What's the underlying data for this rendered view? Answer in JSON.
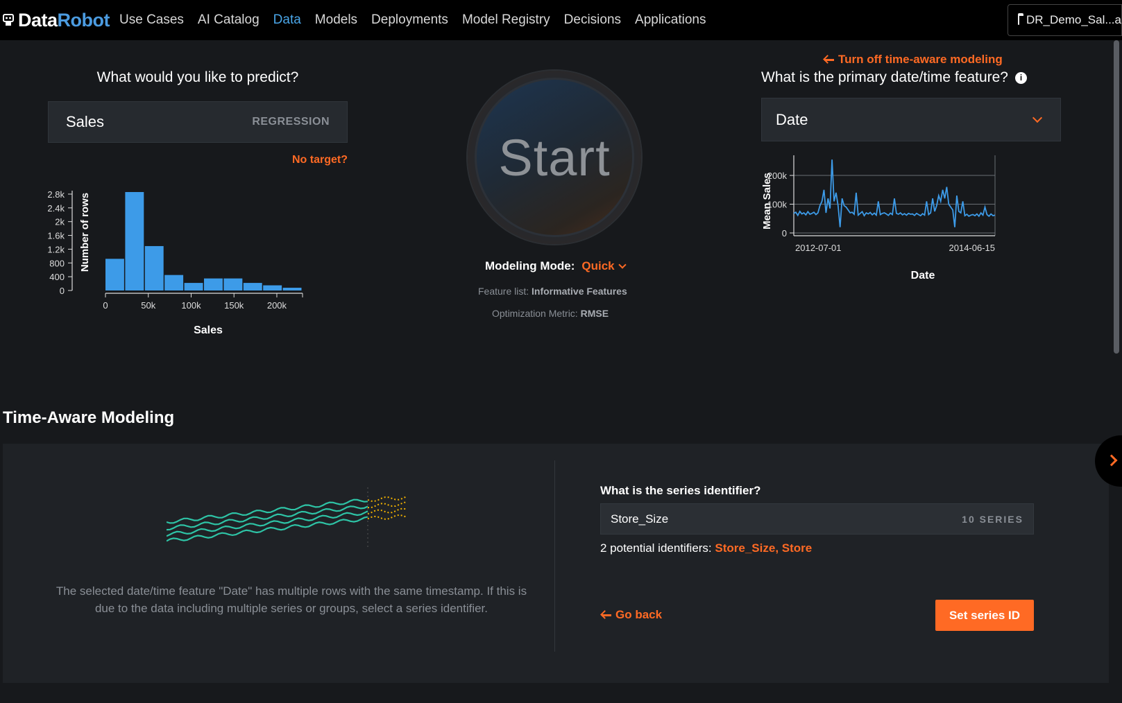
{
  "nav": {
    "brand_data": "Data",
    "brand_robot": "Robot",
    "items": [
      "Use Cases",
      "AI Catalog",
      "Data",
      "Models",
      "Deployments",
      "Model Registry",
      "Decisions",
      "Applications"
    ],
    "active": "Data",
    "project_name": "DR_Demo_Sal...a"
  },
  "target": {
    "question": "What would you like to predict?",
    "value": "Sales",
    "type": "REGRESSION",
    "no_target": "No target?"
  },
  "histogram": {
    "type": "bar",
    "xlabel": "Sales",
    "ylabel": "Number of rows",
    "y_ticks": [
      "0",
      "400",
      "800",
      "1.2k",
      "1.6k",
      "2k",
      "2.4k",
      "2.8k"
    ],
    "x_ticks": [
      "0",
      "50k",
      "100k",
      "150k",
      "200k"
    ],
    "bin_edges": [
      0,
      23000,
      46000,
      69000,
      92000,
      115000,
      138000,
      161000,
      184000,
      207000,
      230000
    ],
    "values": [
      920,
      2860,
      1290,
      450,
      220,
      350,
      350,
      220,
      150,
      80
    ],
    "ylim": [
      0,
      2900
    ]
  },
  "start": {
    "label": "Start",
    "mode_label": "Modeling Mode:",
    "mode_value": "Quick",
    "feature_list_label": "Feature list:",
    "feature_list_value": "Informative Features",
    "metric_label": "Optimization Metric:",
    "metric_value": "RMSE"
  },
  "datetime": {
    "turn_off": "Turn off time-aware modeling",
    "question": "What is the primary date/time feature?",
    "info": "i",
    "selected": "Date"
  },
  "chart_data": {
    "type": "line",
    "xlabel": "Date",
    "ylabel": "Mean Sales",
    "x_ticks": [
      "2012-07-01",
      "2014-06-15"
    ],
    "y_ticks": [
      "0",
      "100k",
      "200k"
    ],
    "ylim": [
      0,
      270000
    ],
    "series": [
      {
        "color": "#3d9be8",
        "x": [
          0,
          0.01,
          0.02,
          0.03,
          0.04,
          0.05,
          0.06,
          0.07,
          0.08,
          0.09,
          0.1,
          0.11,
          0.12,
          0.13,
          0.14,
          0.15,
          0.16,
          0.17,
          0.18,
          0.19,
          0.2,
          0.21,
          0.22,
          0.23,
          0.24,
          0.25,
          0.26,
          0.27,
          0.28,
          0.29,
          0.3,
          0.31,
          0.32,
          0.33,
          0.34,
          0.35,
          0.36,
          0.37,
          0.38,
          0.39,
          0.4,
          0.41,
          0.42,
          0.43,
          0.44,
          0.45,
          0.46,
          0.47,
          0.48,
          0.49,
          0.5,
          0.51,
          0.52,
          0.53,
          0.54,
          0.55,
          0.56,
          0.57,
          0.58,
          0.59,
          0.6,
          0.61,
          0.62,
          0.63,
          0.64,
          0.65,
          0.66,
          0.67,
          0.68,
          0.69,
          0.7,
          0.71,
          0.72,
          0.73,
          0.74,
          0.75,
          0.76,
          0.77,
          0.78,
          0.79,
          0.8,
          0.81,
          0.82,
          0.83,
          0.84,
          0.85,
          0.86,
          0.87,
          0.88,
          0.89,
          0.9,
          0.91,
          0.92,
          0.93,
          0.94,
          0.95,
          0.96,
          0.97,
          0.98,
          0.99,
          1.0
        ],
        "y": [
          68000,
          72000,
          61000,
          75000,
          66000,
          70000,
          63000,
          74000,
          65000,
          68000,
          72000,
          64000,
          70000,
          95000,
          110000,
          150000,
          70000,
          120000,
          85000,
          255000,
          110000,
          140000,
          95000,
          20000,
          120000,
          95000,
          90000,
          80000,
          70000,
          72000,
          65000,
          140000,
          62000,
          68000,
          74000,
          60000,
          70000,
          66000,
          71000,
          63000,
          69000,
          62000,
          110000,
          64000,
          68000,
          70000,
          66000,
          61000,
          69000,
          64000,
          120000,
          68000,
          65000,
          70000,
          63000,
          67000,
          62000,
          68000,
          65000,
          66000,
          61000,
          68000,
          64000,
          60000,
          67000,
          62000,
          110000,
          64000,
          70000,
          120000,
          75000,
          95000,
          130000,
          110000,
          150000,
          120000,
          160000,
          100000,
          90000,
          80000,
          20000,
          130000,
          75000,
          70000,
          110000,
          60000,
          65000,
          58000,
          62000,
          64000,
          60000,
          66000,
          58000,
          70000,
          62000,
          90000,
          64000,
          58000,
          66000,
          60000,
          62000
        ]
      }
    ]
  },
  "time_aware": {
    "heading": "Time-Aware Modeling",
    "description": "The selected date/time feature \"Date\" has multiple rows with the same timestamp. If this is due to the data including multiple series or groups, select a series identifier.",
    "series_question": "What is the series identifier?",
    "series_value": "Store_Size",
    "series_count": "10 SERIES",
    "potential_label": "2 potential identifiers:",
    "potential_values": "Store_Size, Store",
    "go_back": "Go back",
    "set_button": "Set series ID"
  },
  "colors": {
    "accent": "#ff6a24",
    "brand_blue": "#4b9be0",
    "bar": "#3d9be8",
    "series_line": "#2ec4a6",
    "forecast_dots": "#f5b400"
  }
}
